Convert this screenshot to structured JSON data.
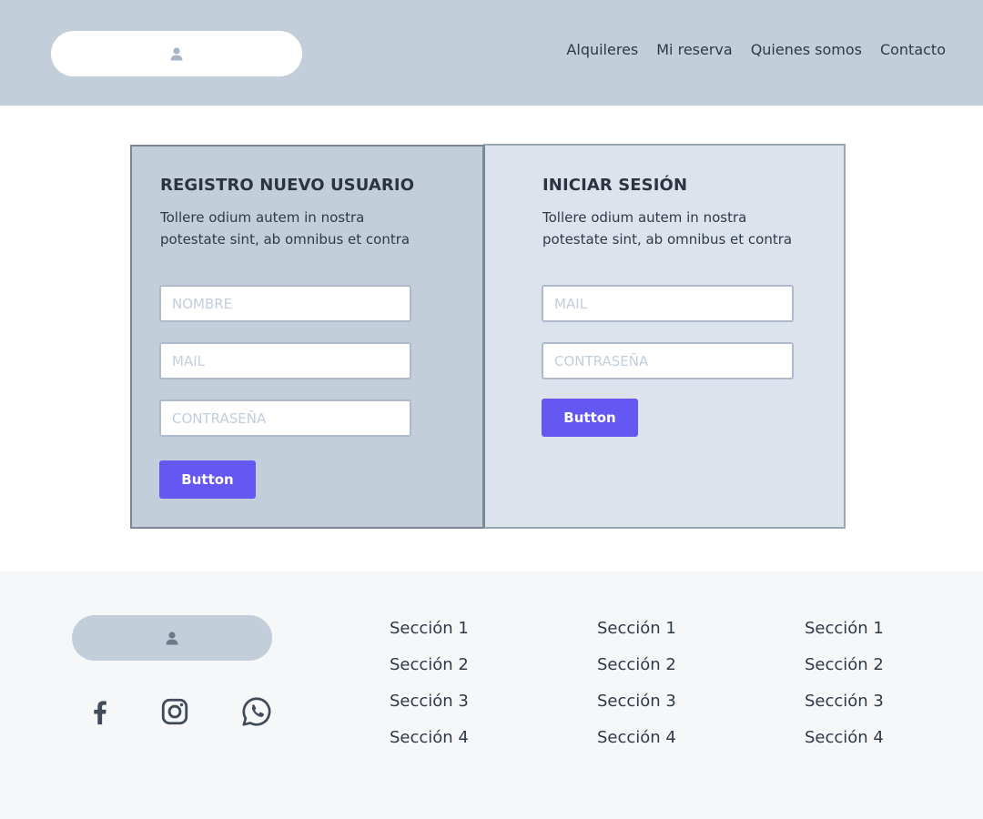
{
  "header": {
    "logo_icon": "user-icon",
    "nav": [
      "Alquileres",
      "Mi reserva",
      "Quienes somos",
      "Contacto"
    ]
  },
  "register": {
    "title": "REGISTRO NUEVO USUARIO",
    "description": "Tollere odium autem in nostra potestate sint, ab omnibus et contra",
    "name_placeholder": "NOMBRE",
    "mail_placeholder": "MAIL",
    "password_placeholder": "CONTRASEÑA",
    "button_label": "Button"
  },
  "login": {
    "title": "INICIAR SESIÓN",
    "description": "Tollere odium autem in nostra potestate sint, ab omnibus et contra",
    "mail_placeholder": "MAIL",
    "password_placeholder": "CONTRASEÑA",
    "button_label": "Button"
  },
  "footer": {
    "logo_icon": "user-icon",
    "social_icons": [
      "facebook-icon",
      "instagram-icon",
      "whatsapp-icon"
    ],
    "columns": [
      [
        "Sección 1",
        "Sección 2",
        "Sección 3",
        "Sección 4"
      ],
      [
        "Sección 1",
        "Sección 2",
        "Sección 3",
        "Sección 4"
      ],
      [
        "Sección 1",
        "Sección 2",
        "Sección 3",
        "Sección 4"
      ]
    ]
  },
  "colors": {
    "header_bg": "#c2ced9",
    "accent": "#6457f2",
    "login_bg": "#dde3ec",
    "footer_bg": "#f5f7f9",
    "text": "#2f3a48"
  }
}
